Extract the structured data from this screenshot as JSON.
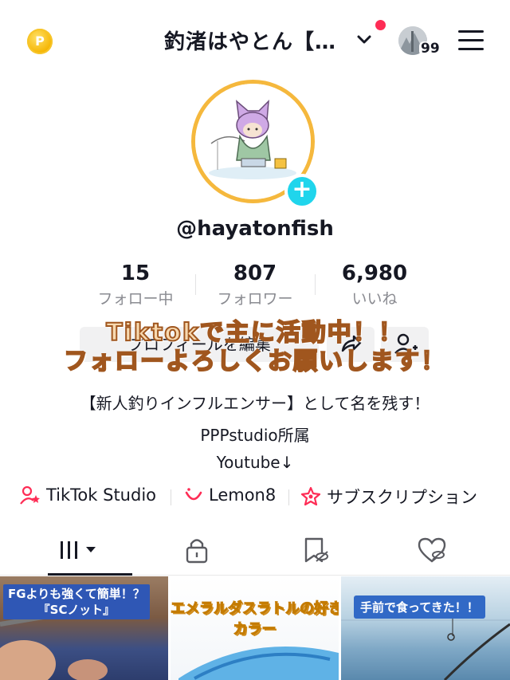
{
  "header": {
    "coin_label": "P",
    "title": "釣渚はやとん【…",
    "badge_count": "99"
  },
  "profile": {
    "handle": "@hayatonfish",
    "stats": [
      {
        "value": "15",
        "label": "フォロー中"
      },
      {
        "value": "807",
        "label": "フォロワー"
      },
      {
        "value": "6,980",
        "label": "いいね"
      }
    ],
    "edit_label": "プロフィールを編集"
  },
  "overlay": {
    "line1": "Tiktokで主に活動中！！",
    "line2": "フォローよろしくお願いします！"
  },
  "bio": {
    "line1": "【新人釣りインフルエンサー】として名を残す！",
    "line2": "PPPstudio所属",
    "line3": "Youtube↓"
  },
  "links": {
    "studio": "TikTok Studio",
    "lemon8": "Lemon8",
    "subscription": "サブスクリプション"
  },
  "videos": [
    {
      "caption_1": "FGよりも強くて簡単！？",
      "caption_2": "『SCノット』"
    },
    {
      "caption_1": "エメラルダスラトルの好き",
      "caption_2": "カラー"
    },
    {
      "caption_1": "手前で食ってきた！！"
    }
  ],
  "colors": {
    "accent_cyan": "#20d5ec",
    "accent_red": "#fe2c55",
    "ring_gold": "#f5b83d"
  }
}
